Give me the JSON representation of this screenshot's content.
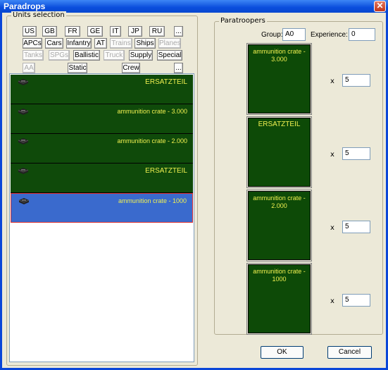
{
  "window": {
    "title": "Paradrops"
  },
  "units_selection": {
    "title": "Units selection",
    "row1": [
      {
        "label": "US",
        "enabled": true
      },
      {
        "label": "GB",
        "enabled": true
      },
      {
        "label": "FR",
        "enabled": true
      },
      {
        "label": "GE",
        "enabled": true
      },
      {
        "label": "IT",
        "enabled": true
      },
      {
        "label": "JP",
        "enabled": true
      },
      {
        "label": "RU",
        "enabled": true
      },
      {
        "label": "...",
        "enabled": true
      }
    ],
    "row2": [
      {
        "label": "APCs",
        "enabled": true
      },
      {
        "label": "Cars",
        "enabled": true
      },
      {
        "label": "Infantry",
        "enabled": true
      },
      {
        "label": "AT",
        "enabled": true
      },
      {
        "label": "Trains",
        "enabled": false
      },
      {
        "label": "Ships",
        "enabled": true
      },
      {
        "label": "Planes",
        "enabled": false
      }
    ],
    "row3": [
      {
        "label": "Tanks",
        "enabled": false
      },
      {
        "label": "SPGs",
        "enabled": false
      },
      {
        "label": "Ballistic",
        "enabled": true
      },
      {
        "label": "Truck",
        "enabled": false
      },
      {
        "label": "Supply",
        "enabled": true
      },
      {
        "label": "Special",
        "enabled": true
      }
    ],
    "row4": [
      {
        "label": "AA",
        "enabled": false
      },
      {
        "label": "Static",
        "enabled": true
      },
      {
        "label": "Crew",
        "enabled": true
      },
      {
        "label": "...",
        "enabled": true
      }
    ],
    "units": [
      {
        "name": "ERSATZTEIL",
        "icon": "crate-icon",
        "selected": false
      },
      {
        "name": "ammunition crate - 3.000",
        "icon": "crate-icon",
        "selected": false
      },
      {
        "name": "ammunition crate - 2.000",
        "icon": "crate-icon",
        "selected": false
      },
      {
        "name": "ERSATZTEIL",
        "icon": "crate-icon",
        "selected": false
      },
      {
        "name": "ammunition crate - 1000",
        "icon": "crate-icon",
        "selected": true
      }
    ]
  },
  "paratroopers": {
    "title": "Paratroopers",
    "group_label": "Group:",
    "group_value": "A0",
    "experience_label": "Experience:",
    "experience_value": "0",
    "multiplier_label": "x",
    "cargo": [
      {
        "name": "ammunition crate - 3.000",
        "count": "5"
      },
      {
        "name": "ERSATZTEIL",
        "count": "5"
      },
      {
        "name": "ammunition crate - 2.000",
        "count": "5"
      },
      {
        "name": "ammunition crate - 1000",
        "count": "5"
      }
    ]
  },
  "buttons": {
    "ok": "OK",
    "cancel": "Cancel"
  },
  "colors": {
    "unit_bg": "#0f4a0a",
    "unit_selected_bg": "#3a6acd",
    "unit_text": "#f0f050",
    "titlebar": "#0a4ddc"
  }
}
